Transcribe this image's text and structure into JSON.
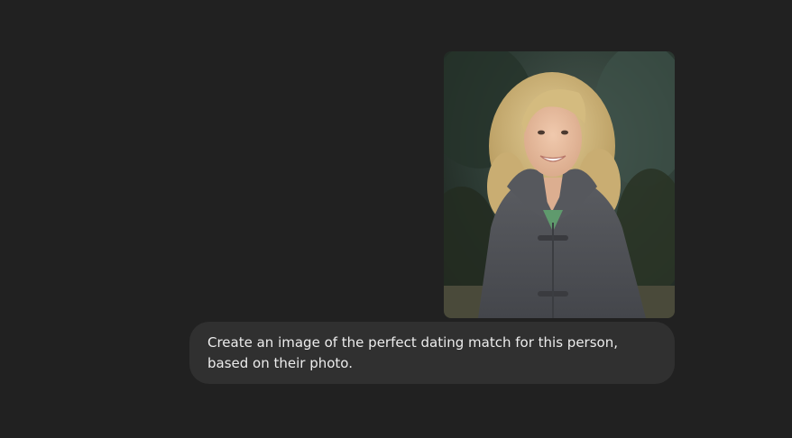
{
  "conversation": {
    "user_message": {
      "attachment": {
        "type": "photo",
        "subject": "person-portrait"
      },
      "text": "Create an image of the perfect dating match for this person, based on their photo."
    }
  },
  "colors": {
    "background": "#212121",
    "bubble": "#303030",
    "text": "#ececec"
  }
}
